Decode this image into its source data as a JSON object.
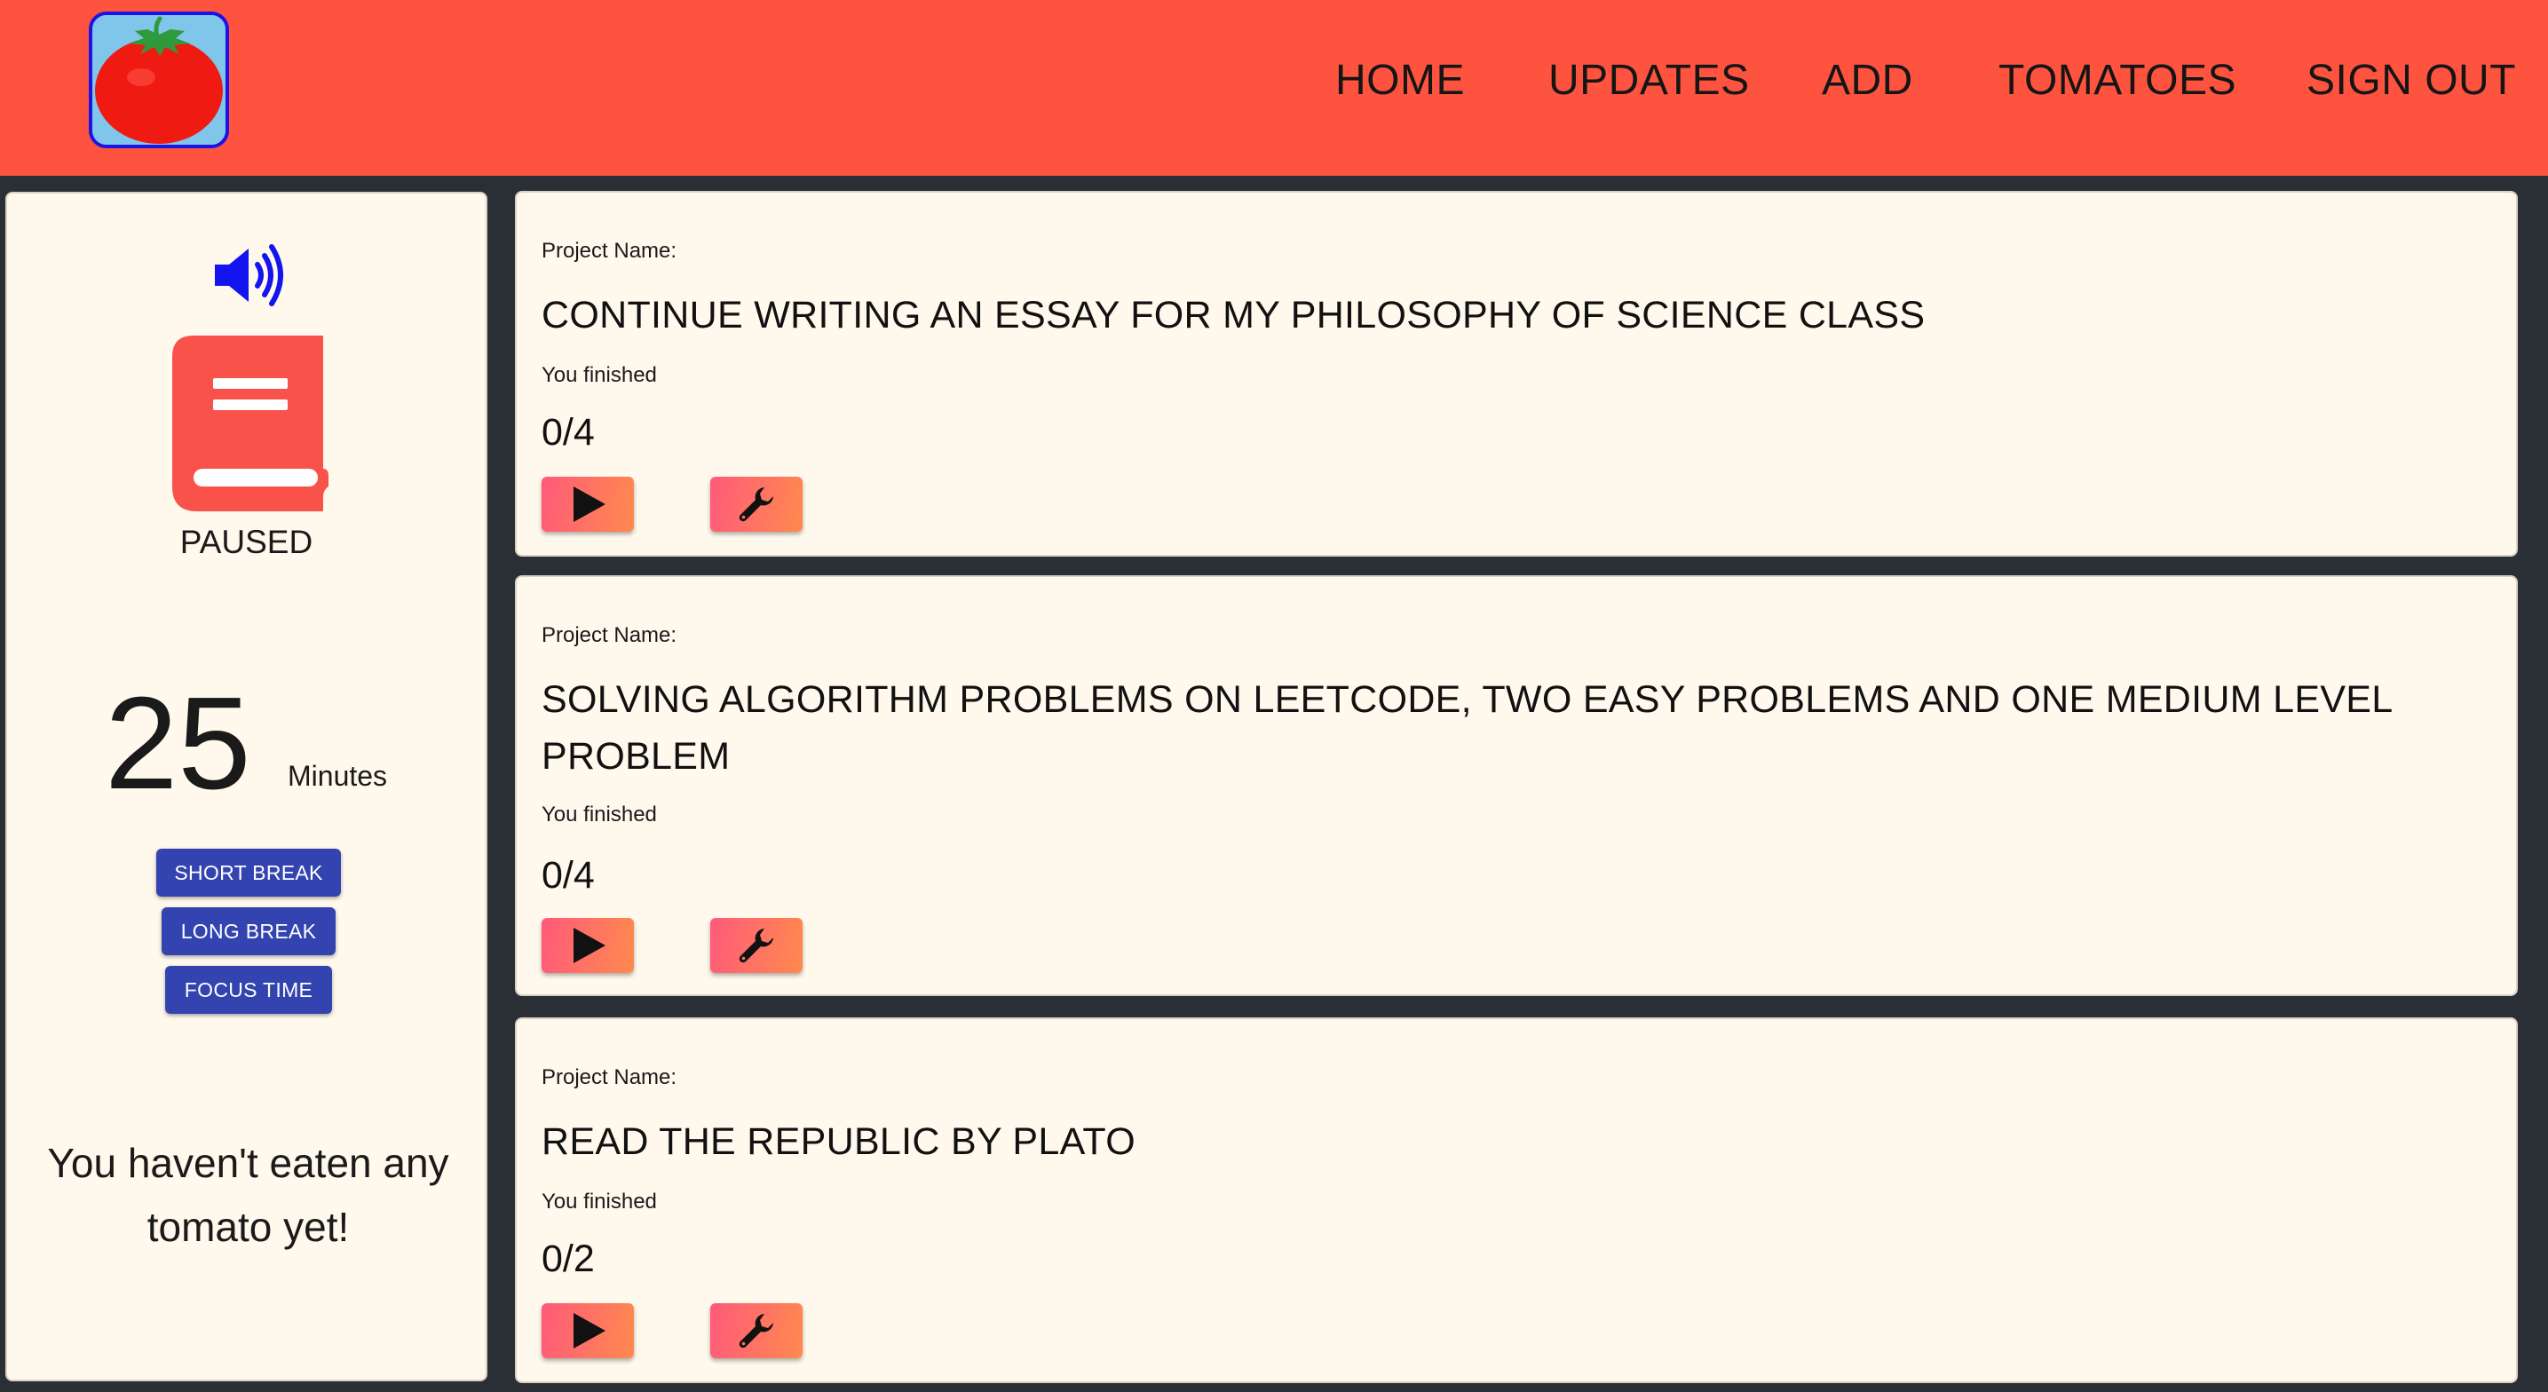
{
  "nav": {
    "links": [
      "HOME",
      "UPDATES",
      "ADD",
      "TOMATOES",
      "SIGN OUT"
    ]
  },
  "timer": {
    "status": "PAUSED",
    "minutes": "25",
    "minutes_label": "Minutes",
    "buttons": [
      "SHORT BREAK",
      "LONG BREAK",
      "FOCUS TIME"
    ],
    "tomato_message": "You haven't eaten any tomato yet!"
  },
  "projects": [
    {
      "name_label": "Project Name:",
      "name": "CONTINUE WRITING AN ESSAY FOR MY PHILOSOPHY OF SCIENCE CLASS",
      "finished_label": "You finished",
      "progress": "0/4"
    },
    {
      "name_label": "Project Name:",
      "name": "SOLVING ALGORITHM PROBLEMS ON LEETCODE, TWO EASY PROBLEMS AND ONE MEDIUM LEVEL PROBLEM",
      "finished_label": "You finished",
      "progress": "0/4"
    },
    {
      "name_label": "Project Name:",
      "name": "READ THE REPUBLIC BY PLATO",
      "finished_label": "You finished",
      "progress": "0/2"
    }
  ],
  "icons": {
    "logo": "tomato-icon",
    "sound": "speaker-icon",
    "status": "book-icon",
    "play": "play-icon",
    "settings": "wrench-icon"
  },
  "colors": {
    "navbar": "#fe533e",
    "page_background": "#2a2f36",
    "card_background": "#fff8ec",
    "mode_button": "#3344b0",
    "action_gradient_start": "#ff5a7a",
    "action_gradient_end": "#ff8a4e",
    "logo_border": "#1c12e6"
  }
}
